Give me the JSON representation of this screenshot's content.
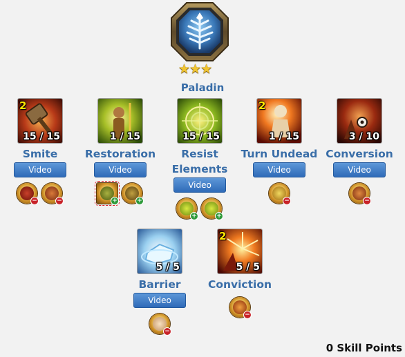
{
  "class_name": "Paladin",
  "class_stars": 3,
  "skill_points_label": "0 Skill Points",
  "skills": [
    {
      "name": "Smite",
      "level": "15 / 15",
      "prereq": "2",
      "video_label": "Video",
      "colors": [
        "#5a1a10",
        "#e07a30"
      ]
    },
    {
      "name": "Restoration",
      "level": "1 / 15",
      "prereq": "",
      "video_label": "Video",
      "colors": [
        "#3a5a10",
        "#e4d050"
      ]
    },
    {
      "name": "Resist\nElements",
      "level": "15 / 15",
      "prereq": "",
      "video_label": "Video",
      "colors": [
        "#2c5010",
        "#c8e050"
      ]
    },
    {
      "name": "Turn Undead",
      "level": "1 / 15",
      "prereq": "2",
      "video_label": "Video",
      "colors": [
        "#7a1808",
        "#ffd070"
      ]
    },
    {
      "name": "Conversion",
      "level": "3 / 10",
      "prereq": "",
      "video_label": "Video",
      "colors": [
        "#4a1208",
        "#d84a30"
      ]
    },
    {
      "name": "Barrier",
      "level": "5 / 5",
      "prereq": "",
      "video_label": "Video",
      "colors": [
        "#3a7ab8",
        "#e8f6ff"
      ]
    },
    {
      "name": "Conviction",
      "level": "5 / 5",
      "prereq": "2",
      "video_label": "",
      "colors": [
        "#5a0c06",
        "#ffb040"
      ]
    }
  ]
}
